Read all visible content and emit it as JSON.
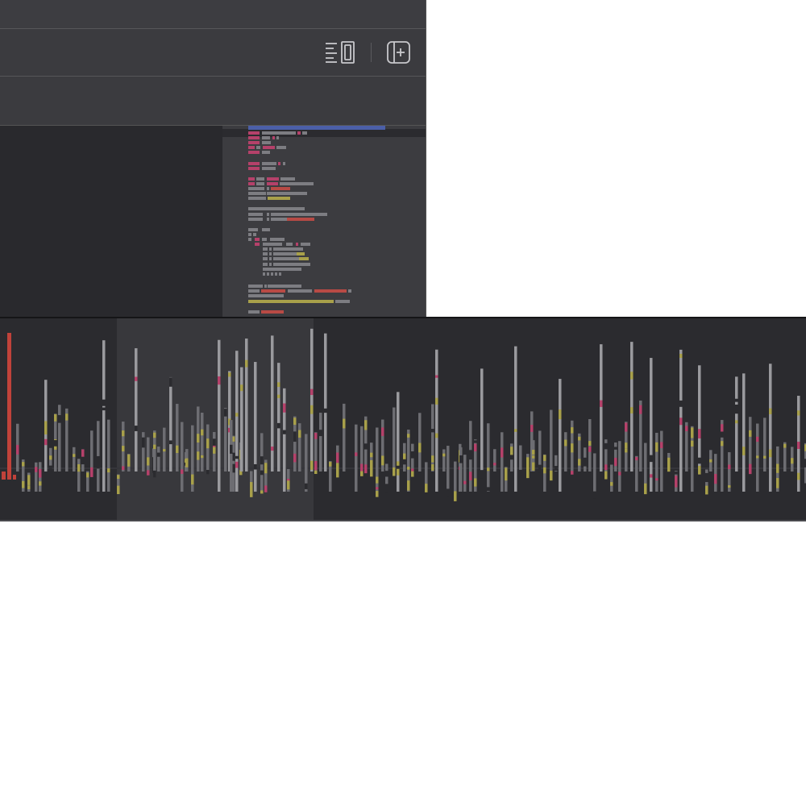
{
  "window": {
    "title": ""
  },
  "toolbar": {
    "buttons": [
      {
        "name": "toggle-inspector",
        "icon": "inspector-layout-icon"
      },
      {
        "name": "add-editor",
        "icon": "add-editor-pane-icon"
      }
    ]
  },
  "minimap": {
    "highlight_color": "#4b5fa8"
  },
  "timeline": {
    "colors": {
      "bar": "#6d6d72",
      "bar_light": "#9a9a9e",
      "accent_red": "#b5416a",
      "accent_yellow": "#a8a04a",
      "bright_red": "#c0423a",
      "selection_bg": "#38383c"
    },
    "selection": {
      "start_fraction": 0.145,
      "end_fraction": 0.389
    }
  }
}
